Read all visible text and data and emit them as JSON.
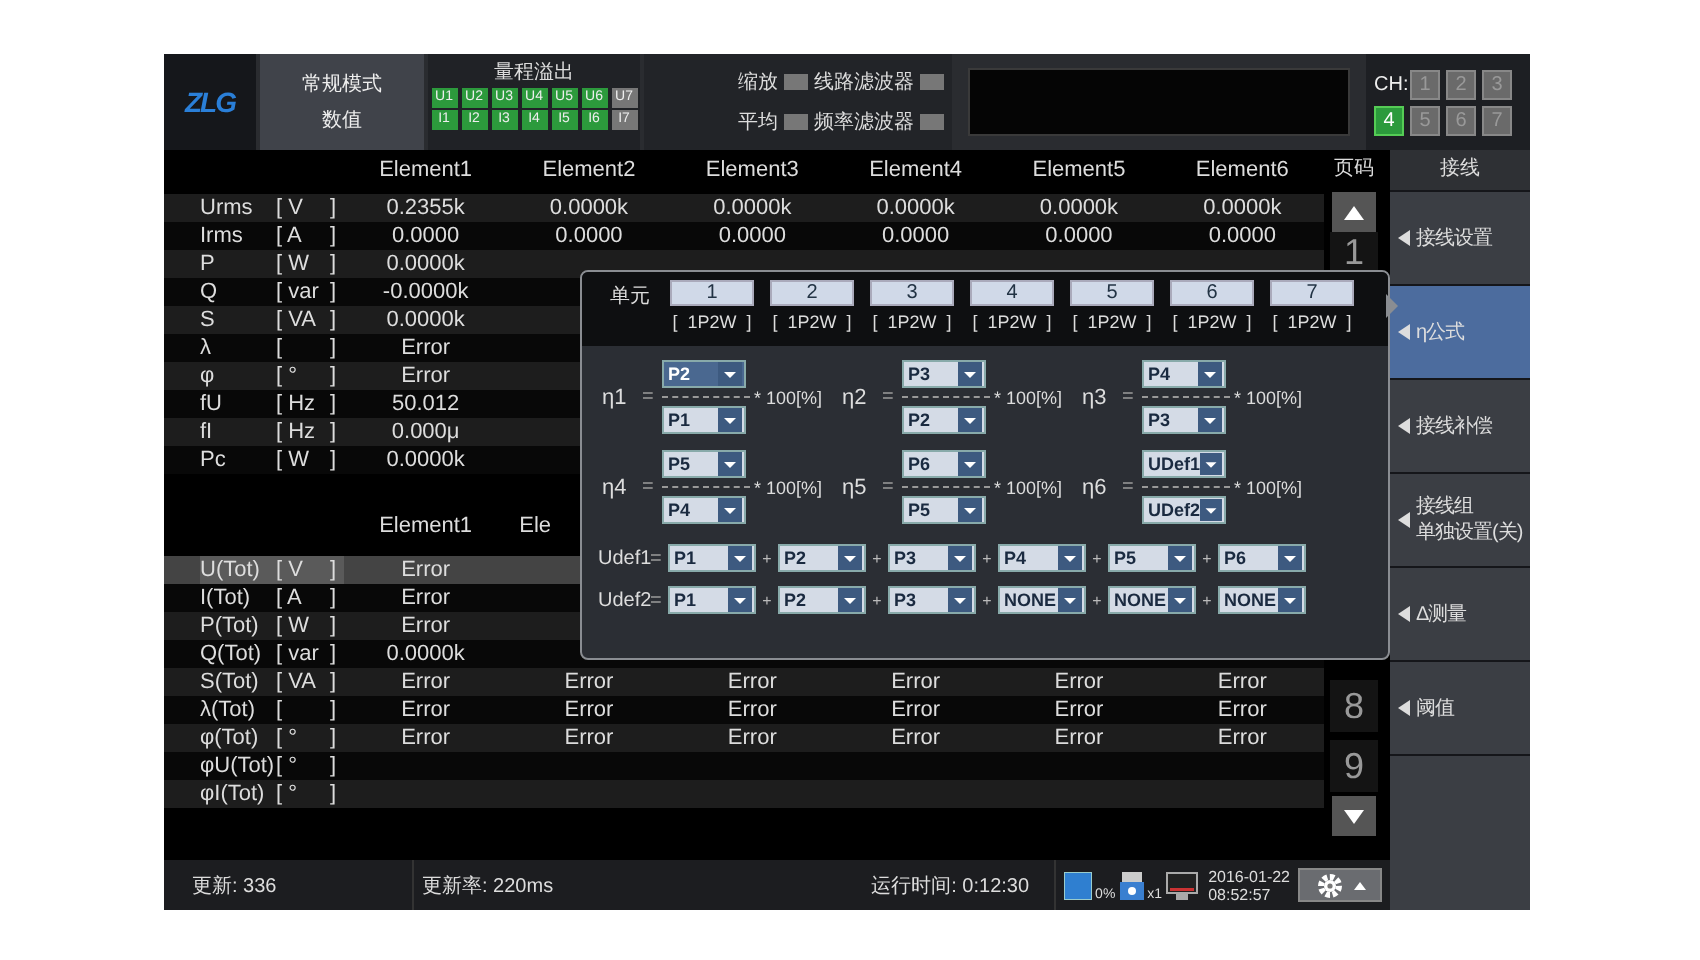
{
  "header": {
    "logo": "ZLG",
    "mode": [
      "常规模式",
      "数值"
    ],
    "overflow": {
      "title": "量程溢出",
      "voltage": [
        {
          "label": "U1",
          "on": true
        },
        {
          "label": "U2",
          "on": true
        },
        {
          "label": "U3",
          "on": true
        },
        {
          "label": "U4",
          "on": true
        },
        {
          "label": "U5",
          "on": true
        },
        {
          "label": "U6",
          "on": true
        },
        {
          "label": "U7",
          "on": false
        }
      ],
      "current": [
        {
          "label": "I1",
          "on": true
        },
        {
          "label": "I2",
          "on": true
        },
        {
          "label": "I3",
          "on": true
        },
        {
          "label": "I4",
          "on": true
        },
        {
          "label": "I5",
          "on": true
        },
        {
          "label": "I6",
          "on": true
        },
        {
          "label": "I7",
          "on": false
        }
      ]
    },
    "toggles": [
      {
        "label": "缩放",
        "on": false
      },
      {
        "label": "线路滤波器",
        "on": false
      },
      {
        "label": "平均",
        "on": false
      },
      {
        "label": "频率滤波器",
        "on": false
      }
    ],
    "channels": {
      "label": "CH:",
      "items": [
        {
          "label": "1",
          "selected": false
        },
        {
          "label": "2",
          "selected": false
        },
        {
          "label": "3",
          "selected": false
        },
        {
          "label": "4",
          "selected": true
        },
        {
          "label": "5",
          "selected": false
        },
        {
          "label": "6",
          "selected": false
        },
        {
          "label": "7",
          "selected": false
        }
      ]
    }
  },
  "table": {
    "columns": [
      "Element1",
      "Element2",
      "Element3",
      "Element4",
      "Element5",
      "Element6"
    ],
    "rows": [
      {
        "name": "Urms",
        "unit": "[ V",
        "close": "]",
        "values": [
          "0.2355k",
          "0.0000k",
          "0.0000k",
          "0.0000k",
          "0.0000k",
          "0.0000k"
        ]
      },
      {
        "name": "Irms",
        "unit": "[ A",
        "close": "]",
        "values": [
          "0.0000",
          "0.0000",
          "0.0000",
          "0.0000",
          "0.0000",
          "0.0000"
        ]
      },
      {
        "name": "P",
        "unit": "[ W",
        "close": "]",
        "values": [
          "0.0000k"
        ]
      },
      {
        "name": "Q",
        "unit": "[ var",
        "close": "]",
        "values": [
          "-0.0000k"
        ]
      },
      {
        "name": "S",
        "unit": "[ VA",
        "close": "]",
        "values": [
          "0.0000k"
        ]
      },
      {
        "name": "λ",
        "unit": "[",
        "close": "]",
        "values": [
          "Error"
        ]
      },
      {
        "name": "φ",
        "unit": "[ °",
        "close": "]",
        "values": [
          "Error"
        ]
      },
      {
        "name": "fU",
        "unit": "[ Hz",
        "close": "]",
        "values": [
          "50.012"
        ]
      },
      {
        "name": "fI",
        "unit": "[ Hz",
        "close": "]",
        "values": [
          "0.000μ"
        ]
      },
      {
        "name": "Pc",
        "unit": "[ W",
        "close": "]",
        "values": [
          "0.0000k"
        ]
      }
    ]
  },
  "total_table": {
    "columns": [
      "Element1",
      "Ele"
    ],
    "rows": [
      {
        "name": "U(Tot)",
        "unit": "[ V",
        "close": "]",
        "selected": true,
        "values": [
          "Error"
        ]
      },
      {
        "name": "I(Tot)",
        "unit": "[ A",
        "close": "]",
        "selected": false,
        "values": [
          "Error"
        ]
      },
      {
        "name": "P(Tot)",
        "unit": "[ W",
        "close": "]",
        "selected": false,
        "values": [
          "Error"
        ]
      },
      {
        "name": "Q(Tot)",
        "unit": "[ var",
        "close": "]",
        "selected": false,
        "values": [
          "0.0000k"
        ]
      },
      {
        "name": "S(Tot)",
        "unit": "[ VA",
        "close": "]",
        "selected": false,
        "values": [
          "Error",
          "Error",
          "Error",
          "Error",
          "Error",
          "Error"
        ]
      },
      {
        "name": "λ(Tot)",
        "unit": "[",
        "close": "]",
        "selected": false,
        "values": [
          "Error",
          "Error",
          "Error",
          "Error",
          "Error",
          "Error"
        ]
      },
      {
        "name": "φ(Tot)",
        "unit": "[ °",
        "close": "]",
        "selected": false,
        "values": [
          "Error",
          "Error",
          "Error",
          "Error",
          "Error",
          "Error"
        ]
      },
      {
        "name": "φU(Tot)",
        "unit": "[ °",
        "close": "]",
        "selected": false,
        "values": []
      },
      {
        "name": "φI(Tot)",
        "unit": "[ °",
        "close": "]",
        "selected": false,
        "values": []
      }
    ]
  },
  "pager": {
    "title": "页码",
    "pages": [
      "1",
      "8",
      "9"
    ]
  },
  "sidebar": {
    "title": "接线",
    "items": [
      {
        "label": "接线设置",
        "selected": false
      },
      {
        "label": "η公式",
        "selected": true
      },
      {
        "label": "接线补偿",
        "selected": false
      },
      {
        "label": "接线组",
        "label2": "单独设置(关)",
        "selected": false
      },
      {
        "label": "Δ测量",
        "selected": false
      },
      {
        "label": "阈值",
        "selected": false
      }
    ]
  },
  "popup": {
    "unit_label": "单元",
    "units": [
      {
        "label": "1",
        "wiring": "[  1P2W  ]"
      },
      {
        "label": "2",
        "wiring": "[  1P2W  ]"
      },
      {
        "label": "3",
        "wiring": "[  1P2W  ]"
      },
      {
        "label": "4",
        "wiring": "[  1P2W  ]"
      },
      {
        "label": "5",
        "wiring": "[  1P2W  ]"
      },
      {
        "label": "6",
        "wiring": "[  1P2W  ]"
      },
      {
        "label": "7",
        "wiring": "[  1P2W  ]"
      }
    ],
    "formulas": [
      {
        "name": "η1",
        "equals": "=",
        "numerator": {
          "value": "P2",
          "focused": true
        },
        "denominator": {
          "value": "P1",
          "focused": false
        },
        "factor": "* 100[%]"
      },
      {
        "name": "η2",
        "equals": "=",
        "numerator": {
          "value": "P3",
          "focused": false
        },
        "denominator": {
          "value": "P2",
          "focused": false
        },
        "factor": "* 100[%]"
      },
      {
        "name": "η3",
        "equals": "=",
        "numerator": {
          "value": "P4",
          "focused": false
        },
        "denominator": {
          "value": "P3",
          "focused": false
        },
        "factor": "* 100[%]"
      },
      {
        "name": "η4",
        "equals": "=",
        "numerator": {
          "value": "P5",
          "focused": false
        },
        "denominator": {
          "value": "P4",
          "focused": false
        },
        "factor": "* 100[%]"
      },
      {
        "name": "η5",
        "equals": "=",
        "numerator": {
          "value": "P6",
          "focused": false
        },
        "denominator": {
          "value": "P5",
          "focused": false
        },
        "factor": "* 100[%]"
      },
      {
        "name": "η6",
        "equals": "=",
        "numerator": {
          "value": "UDef1",
          "focused": false
        },
        "denominator": {
          "value": "UDef2",
          "focused": false
        },
        "factor": "* 100[%]"
      }
    ],
    "udefs": [
      {
        "name": "Udef1",
        "equals": "=",
        "terms": [
          {
            "value": "P1"
          },
          {
            "op": "+",
            "value": "P2"
          },
          {
            "op": "+",
            "value": "P3"
          },
          {
            "op": "+",
            "value": "P4"
          },
          {
            "op": "+",
            "value": "P5"
          },
          {
            "op": "+",
            "value": "P6"
          }
        ]
      },
      {
        "name": "Udef2",
        "equals": "=",
        "terms": [
          {
            "value": "P1"
          },
          {
            "op": "+",
            "value": "P2"
          },
          {
            "op": "+",
            "value": "P3"
          },
          {
            "op": "+",
            "value": "NONE"
          },
          {
            "op": "+",
            "value": "NONE"
          },
          {
            "op": "+",
            "value": "NONE"
          }
        ]
      }
    ]
  },
  "status_bar": {
    "updates": "更新: 336",
    "rate": "更新率: 220ms",
    "runtime": "运行时间: 0:12:30",
    "storage": "0%",
    "device": "x1",
    "date": "2016-01-22",
    "time": "08:52:57"
  }
}
